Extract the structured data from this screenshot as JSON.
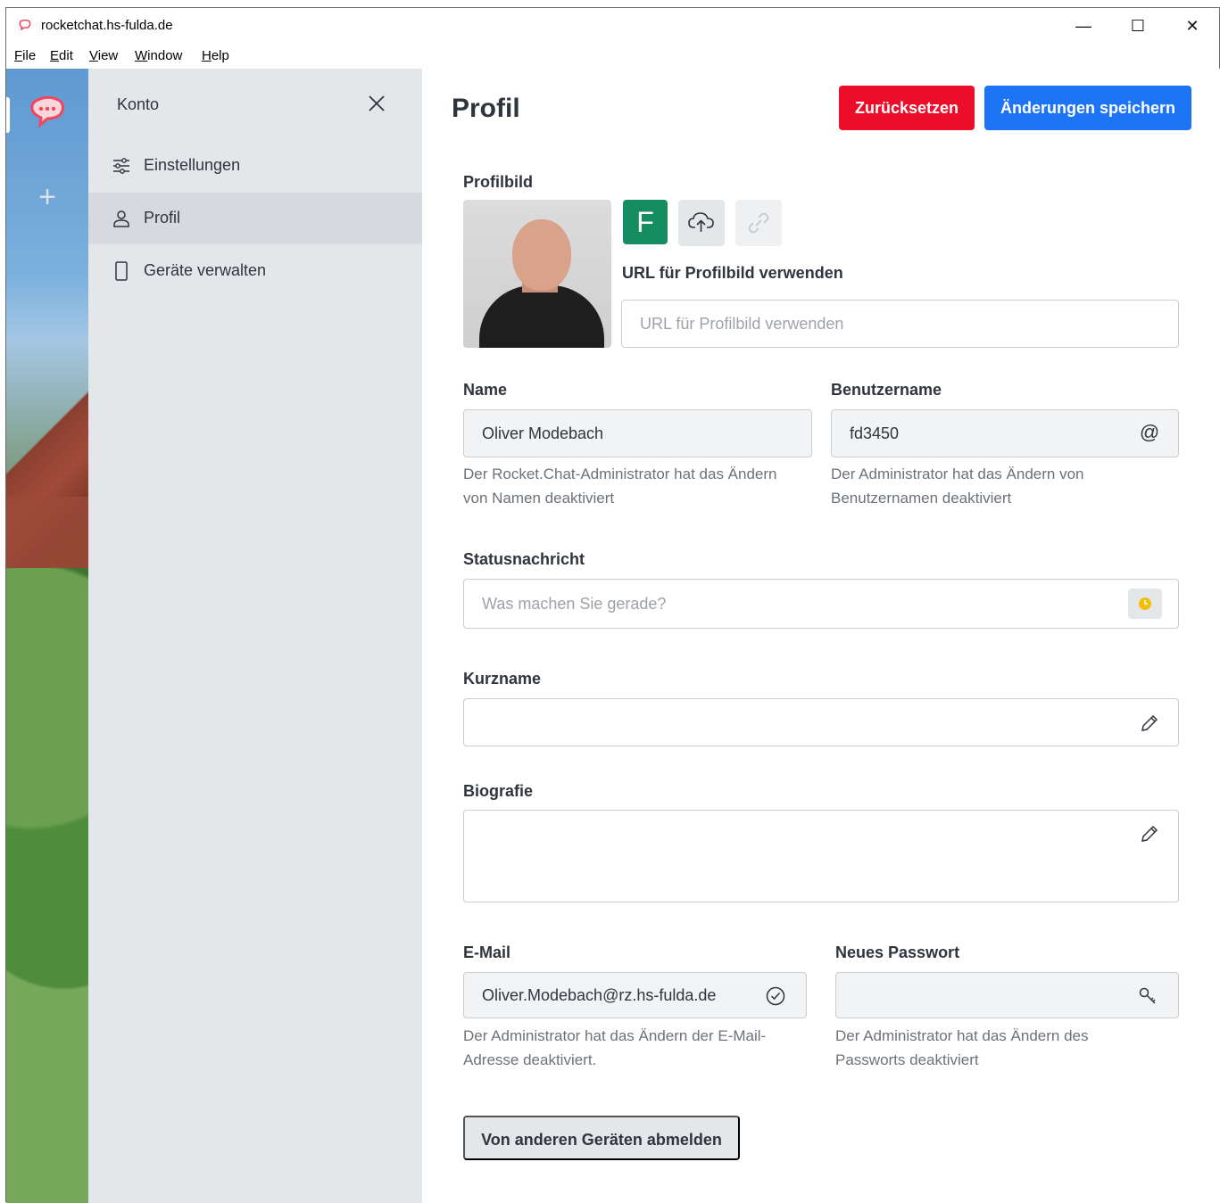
{
  "window": {
    "title": "rocketchat.hs-fulda.de",
    "controls": {
      "minimize": "—",
      "maximize": "☐",
      "close": "✕"
    }
  },
  "menubar": {
    "items": [
      {
        "label": "File",
        "accel": "F",
        "rest": "ile"
      },
      {
        "label": "Edit",
        "accel": "E",
        "rest": "dit"
      },
      {
        "label": "View",
        "accel": "V",
        "rest": "iew"
      },
      {
        "label": "Window",
        "accel": "W",
        "rest": "indow"
      },
      {
        "label": "Help",
        "accel": "H",
        "rest": "elp"
      }
    ]
  },
  "rail": {
    "add_symbol": "+"
  },
  "sidebar": {
    "title": "Konto",
    "items": [
      {
        "label": "Einstellungen",
        "icon": "sliders-icon"
      },
      {
        "label": "Profil",
        "icon": "user-icon",
        "active": true
      },
      {
        "label": "Geräte verwalten",
        "icon": "mobile-icon"
      }
    ]
  },
  "main": {
    "title": "Profil",
    "reset_label": "Zurücksetzen",
    "save_label": "Änderungen speichern",
    "avatar": {
      "label": "Profilbild",
      "letter": "F",
      "url_label": "URL für Profilbild verwenden",
      "url_placeholder": "URL für Profilbild verwenden"
    },
    "name": {
      "label": "Name",
      "value": "Oliver Modebach",
      "hint_line1": "Der Rocket.Chat-Administrator hat das Ändern",
      "hint_line2": "von Namen deaktiviert"
    },
    "username": {
      "label": "Benutzername",
      "value": "fd3450",
      "icon_glyph": "@",
      "hint_line1": "Der Administrator hat das Ändern von",
      "hint_line2": "Benutzernamen deaktiviert"
    },
    "status": {
      "label": "Statusnachricht",
      "placeholder": "Was machen Sie gerade?",
      "status_color": "#f3be08"
    },
    "nickname": {
      "label": "Kurzname",
      "value": ""
    },
    "bio": {
      "label": "Biografie",
      "value": ""
    },
    "email": {
      "label": "E-Mail",
      "value": "Oliver.Modebach@rz.hs-fulda.de",
      "hint_line1": "Der Administrator hat das Ändern der E-Mail-",
      "hint_line2": "Adresse deaktiviert."
    },
    "password": {
      "label": "Neues Passwort",
      "value": "",
      "hint_line1": "Der Administrator hat das Ändern des",
      "hint_line2": "Passworts deaktiviert"
    },
    "logout_label": "Von anderen Geräten abmelden"
  },
  "colors": {
    "danger": "#ec0d2a",
    "primary": "#1d74f5",
    "avatar_letter_bg": "#158d60",
    "rocket_red": "#f5455c"
  }
}
